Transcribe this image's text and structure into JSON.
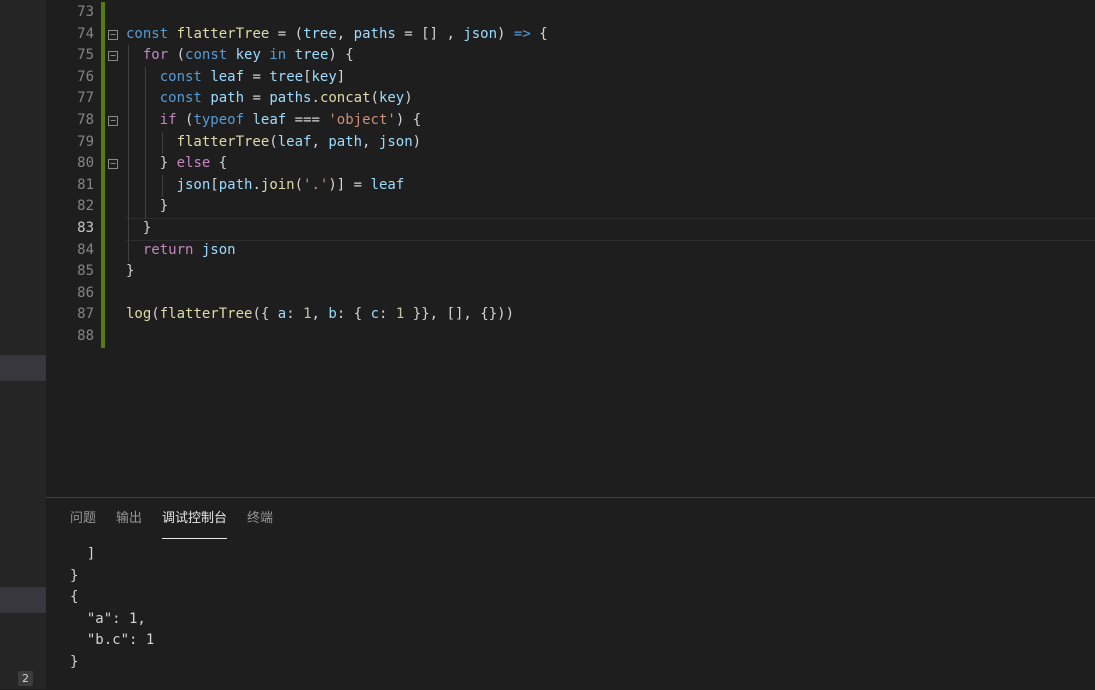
{
  "editor": {
    "lines": [
      {
        "n": "73",
        "text": ""
      },
      {
        "n": "74",
        "text": "const flatterTree = (tree, paths = [] , json) => {"
      },
      {
        "n": "75",
        "text": "  for (const key in tree) {"
      },
      {
        "n": "76",
        "text": "    const leaf = tree[key]"
      },
      {
        "n": "77",
        "text": "    const path = paths.concat(key)"
      },
      {
        "n": "78",
        "text": "    if (typeof leaf === 'object') {"
      },
      {
        "n": "79",
        "text": "      flatterTree(leaf, path, json)"
      },
      {
        "n": "80",
        "text": "    } else {"
      },
      {
        "n": "81",
        "text": "      json[path.join('.')] = leaf"
      },
      {
        "n": "82",
        "text": "    }"
      },
      {
        "n": "83",
        "text": "  }"
      },
      {
        "n": "84",
        "text": "  return json"
      },
      {
        "n": "85",
        "text": "}"
      },
      {
        "n": "86",
        "text": ""
      },
      {
        "n": "87",
        "text": "log(flatterTree({ a: 1, b: { c: 1 }}, [], {}))"
      },
      {
        "n": "88",
        "text": ""
      }
    ],
    "active_line": "83",
    "fold_icon_glyph": "−",
    "fold_icon_name": "fold-minus-icon",
    "colors": {
      "keyword": "#569cd6",
      "control": "#c586c0",
      "function": "#dcdcaa",
      "variable": "#9cdcfe",
      "string": "#ce9178",
      "number": "#b5cea8",
      "gutter_change": "#587c0c"
    }
  },
  "panel": {
    "tabs": [
      {
        "label": "问题"
      },
      {
        "label": "输出"
      },
      {
        "label": "调试控制台"
      },
      {
        "label": "终端"
      }
    ],
    "active_tab": "调试控制台",
    "console_lines": [
      "  ]",
      "}",
      "{",
      "  \"a\": 1,",
      "  \"b.c\": 1",
      "}"
    ]
  },
  "sidebar": {
    "badge": "2"
  }
}
